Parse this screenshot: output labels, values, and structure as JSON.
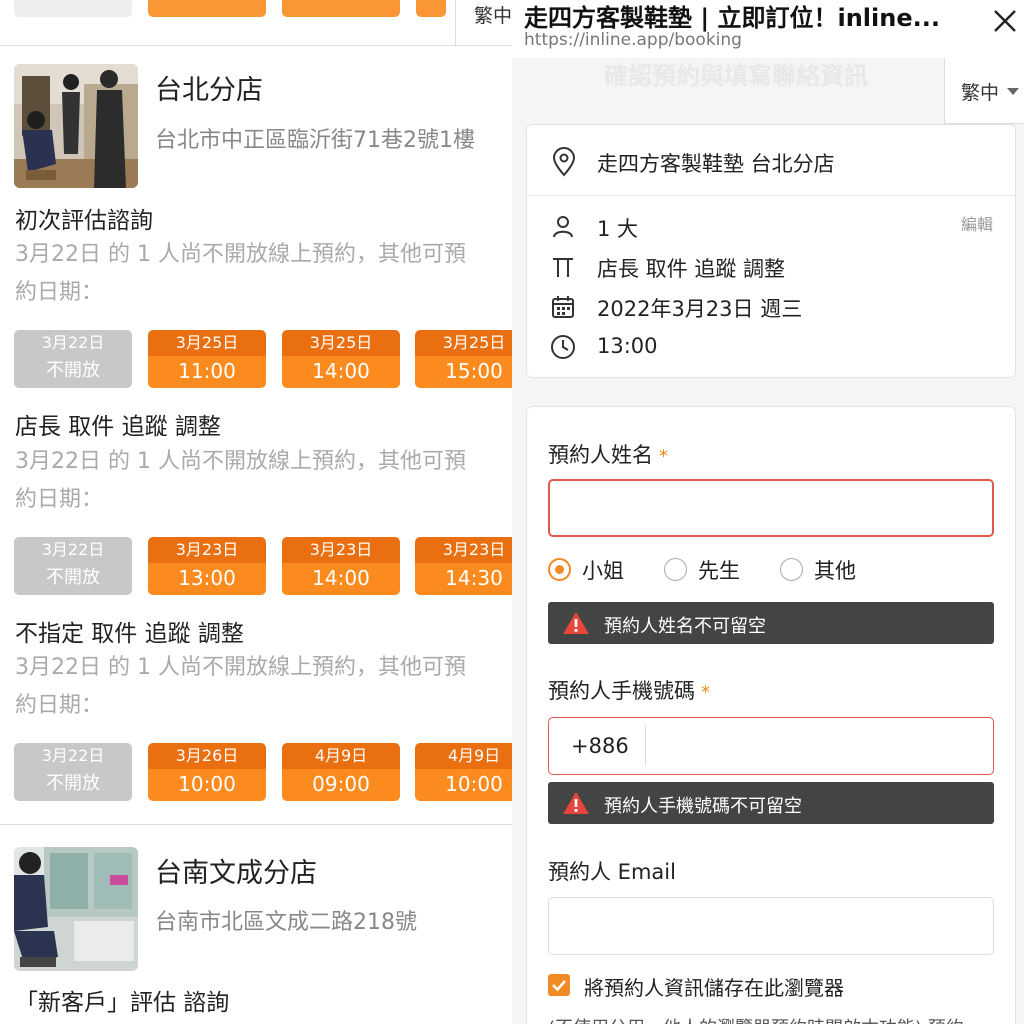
{
  "left": {
    "top_lang": "繁中",
    "stores": [
      {
        "name": "台北分店",
        "address": "台北市中正區臨沂街71巷2號1樓",
        "services": [
          {
            "title": "初次評估諮詢",
            "note_line1": "3月22日 的 1 人尚不開放線上預約，其他可預",
            "note_line2": "約日期：",
            "slots": [
              {
                "date": "3月22日",
                "time": "不開放",
                "status": "closed"
              },
              {
                "date": "3月25日",
                "time": "11:00",
                "status": "open"
              },
              {
                "date": "3月25日",
                "time": "14:00",
                "status": "open"
              },
              {
                "date": "3月25日",
                "time": "15:00",
                "status": "open"
              }
            ]
          },
          {
            "title": "店長 取件 追蹤 調整",
            "note_line1": "3月22日 的 1 人尚不開放線上預約，其他可預",
            "note_line2": "約日期：",
            "slots": [
              {
                "date": "3月22日",
                "time": "不開放",
                "status": "closed"
              },
              {
                "date": "3月23日",
                "time": "13:00",
                "status": "open"
              },
              {
                "date": "3月23日",
                "time": "14:00",
                "status": "open"
              },
              {
                "date": "3月23日",
                "time": "14:30",
                "status": "open"
              }
            ]
          },
          {
            "title": "不指定 取件 追蹤 調整",
            "note_line1": "3月22日 的 1 人尚不開放線上預約，其他可預",
            "note_line2": "約日期：",
            "slots": [
              {
                "date": "3月22日",
                "time": "不開放",
                "status": "closed"
              },
              {
                "date": "3月26日",
                "time": "10:00",
                "status": "open"
              },
              {
                "date": "4月9日",
                "time": "09:00",
                "status": "open"
              },
              {
                "date": "4月9日",
                "time": "10:00",
                "status": "open"
              }
            ]
          }
        ]
      },
      {
        "name": "台南文成分店",
        "address": "台南市北區文成二路218號",
        "services": [
          {
            "title": "「新客戶」評估 諮詢"
          }
        ]
      }
    ]
  },
  "right": {
    "window_title": "走四方客製鞋墊 | 立即訂位！inline...",
    "url": "https://inline.app/booking",
    "ghost_title": "確認預約與填寫聯絡資訊",
    "lang": "繁中",
    "summary": {
      "store": "走四方客製鞋墊 台北分店",
      "party": "1 大",
      "edit_label": "編輯",
      "service": "店長 取件 追蹤 調整",
      "date": "2022年3月23日 週三",
      "time": "13:00"
    },
    "form": {
      "name_label": "預約人姓名",
      "required_mark": "*",
      "name_value": "",
      "salutations": [
        "小姐",
        "先生",
        "其他"
      ],
      "salutation_selected": "小姐",
      "name_error": "預約人姓名不可留空",
      "phone_label": "預約人手機號碼",
      "phone_code": "+886",
      "phone_value": "",
      "phone_error": "預約人手機號碼不可留空",
      "email_label": "預約人 Email",
      "email_value": "",
      "save_label": "將預約人資訊儲存在此瀏覽器",
      "save_checked": true,
      "cut_text": "(不使用公用、他人的瀏覽器預約時開啟本功能) 預約"
    }
  },
  "colors": {
    "accent": "#f08a24",
    "slot_date": "#ea6f10",
    "slot_time": "#fb8b1e",
    "closed": "#c8c8c8",
    "error_border": "#e0584f",
    "alert_bg": "#444444",
    "alert_icon": "#e8453c"
  }
}
